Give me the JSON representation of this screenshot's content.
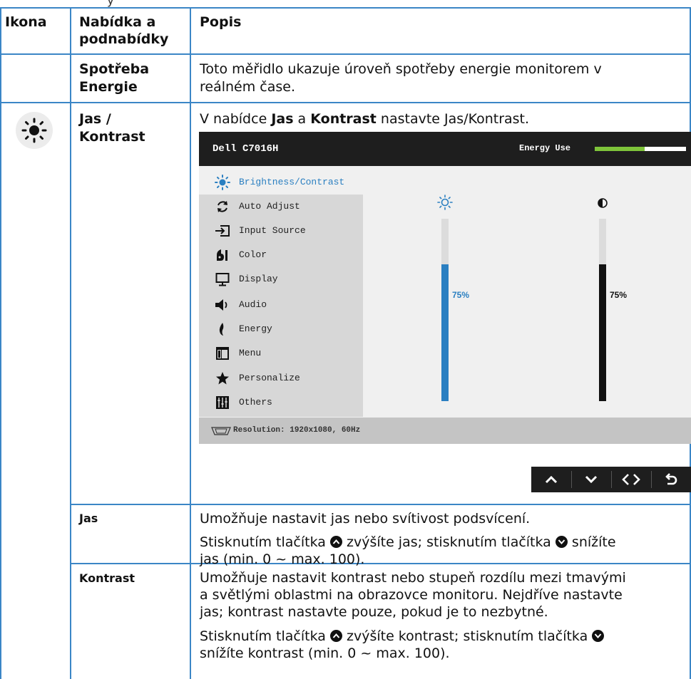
{
  "header": {
    "col_icon": "Ikona",
    "col_menu_line1": "Nabídka a",
    "col_menu_line2": "podnabídky",
    "col_desc": "Popis"
  },
  "rows": {
    "energy": {
      "menu_line1": "Spotřeba",
      "menu_line2": "Energie",
      "desc_line1": "Toto měřidlo ukazuje úroveň spotřeby energie monitorem v",
      "desc_line2": "reálném čase."
    },
    "brightness": {
      "icon": "sun-icon",
      "menu_line1": "Jas /",
      "menu_line2": "Kontrast",
      "desc_pre": "V nabídce ",
      "desc_b1": "Jas",
      "desc_mid": " a ",
      "desc_b2": "Kontrast",
      "desc_post": " nastavte Jas/Kontrast."
    },
    "jas": {
      "menu": "Jas",
      "desc_line1": "Umožňuje nastavit jas nebo svítivost podsvícení.",
      "desc2_a": "Stisknutím tlačítka ",
      "desc2_b": " zvýšíte jas; stisknutím tlačítka ",
      "desc2_c": " snížíte",
      "desc3": "jas (min. 0 ~ max. 100)."
    },
    "kontrast": {
      "menu": "Kontrast",
      "desc_line1": "Umožňuje nastavit kontrast nebo stupeň rozdílu mezi tmavými",
      "desc_line2": "a světlými oblastmi na obrazovce monitoru. Nejdříve nastavte",
      "desc_line3": "jas; kontrast nastavte pouze, pokud je to nezbytné.",
      "desc4_a": "Stisknutím tlačítka ",
      "desc4_b": " zvýšíte kontrast; stisknutím tlačítka ",
      "desc5": "snížíte kontrast (min. 0 ~ max. 100)."
    }
  },
  "osd": {
    "title": "Dell C7016H",
    "energy_label": "Energy Use",
    "energy_level": 0.55,
    "menu_items": [
      {
        "label": "Brightness/Contrast",
        "icon": "sun-icon"
      },
      {
        "label": "Auto Adjust",
        "icon": "auto-adjust-icon"
      },
      {
        "label": "Input Source",
        "icon": "input-source-icon"
      },
      {
        "label": "Color",
        "icon": "color-icon"
      },
      {
        "label": "Display",
        "icon": "display-icon"
      },
      {
        "label": "Audio",
        "icon": "speaker-icon"
      },
      {
        "label": "Energy",
        "icon": "energy-icon"
      },
      {
        "label": "Menu",
        "icon": "menu-icon"
      },
      {
        "label": "Personalize",
        "icon": "star-icon"
      },
      {
        "label": "Others",
        "icon": "others-icon"
      }
    ],
    "brightness_value": 75,
    "brightness_label": "75%",
    "contrast_value": 75,
    "contrast_label": "75%",
    "resolution": "Resolution: 1920x1080, 60Hz",
    "colors": {
      "accent": "#2a7fc1",
      "energy": "#7ec43a",
      "osd_bg": "#1e1e1e"
    }
  },
  "nav_buttons": [
    "up-icon",
    "down-icon",
    "left-right-icon",
    "back-icon"
  ]
}
